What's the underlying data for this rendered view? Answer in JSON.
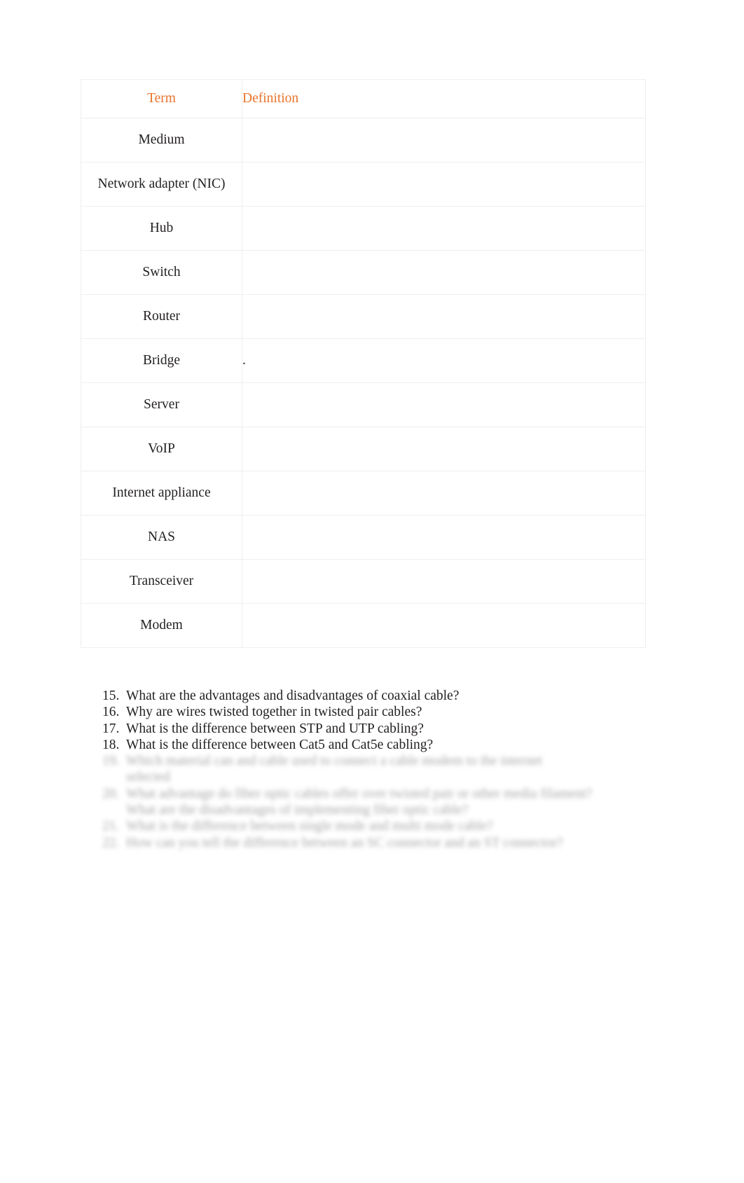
{
  "document": {
    "type": "worksheet-page"
  },
  "table": {
    "headers": {
      "term": "Term",
      "definition": "Definition"
    },
    "header_color": "#e8732a",
    "rows": [
      {
        "term": "Medium",
        "definition": ""
      },
      {
        "term": "Network adapter (NIC)",
        "definition": ""
      },
      {
        "term": "Hub",
        "definition": ""
      },
      {
        "term": "Switch",
        "definition": ""
      },
      {
        "term": "Router",
        "definition": ""
      },
      {
        "term": "Bridge",
        "definition": "."
      },
      {
        "term": "Server",
        "definition": ""
      },
      {
        "term": "VoIP",
        "definition": ""
      },
      {
        "term": "Internet appliance",
        "definition": ""
      },
      {
        "term": "NAS",
        "definition": ""
      },
      {
        "term": "Transceiver",
        "definition": ""
      },
      {
        "term": "Modem",
        "definition": ""
      }
    ]
  },
  "questions": [
    {
      "number": "15.",
      "text": "What are the advantages and disadvantages of coaxial cable?",
      "legible": true
    },
    {
      "number": "16.",
      "text": "Why are wires twisted together in twisted pair cables?",
      "legible": true
    },
    {
      "number": "17.",
      "text": "What is the difference between STP and UTP cabling?",
      "legible": true
    },
    {
      "number": "18.",
      "text": "What is the difference between Cat5 and Cat5e cabling?",
      "legible": true
    },
    {
      "number": "19.",
      "text": "Which material can and cable used to connect a cable modem to the internet",
      "legible": false
    },
    {
      "number": "",
      "text": "selected",
      "legible": false,
      "continuation": true
    },
    {
      "number": "20.",
      "text": "What advantage do fiber optic cables offer over twisted pair or other media filament?",
      "legible": false
    },
    {
      "number": "",
      "text": "What are the disadvantages of implementing fiber optic cable?",
      "legible": false,
      "continuation": true
    },
    {
      "number": "21.",
      "text": "What is the difference between single mode and multi mode cable?",
      "legible": false
    },
    {
      "number": "22.",
      "text": "How can you tell the difference between an SC connector and an ST connector?",
      "legible": false
    }
  ]
}
